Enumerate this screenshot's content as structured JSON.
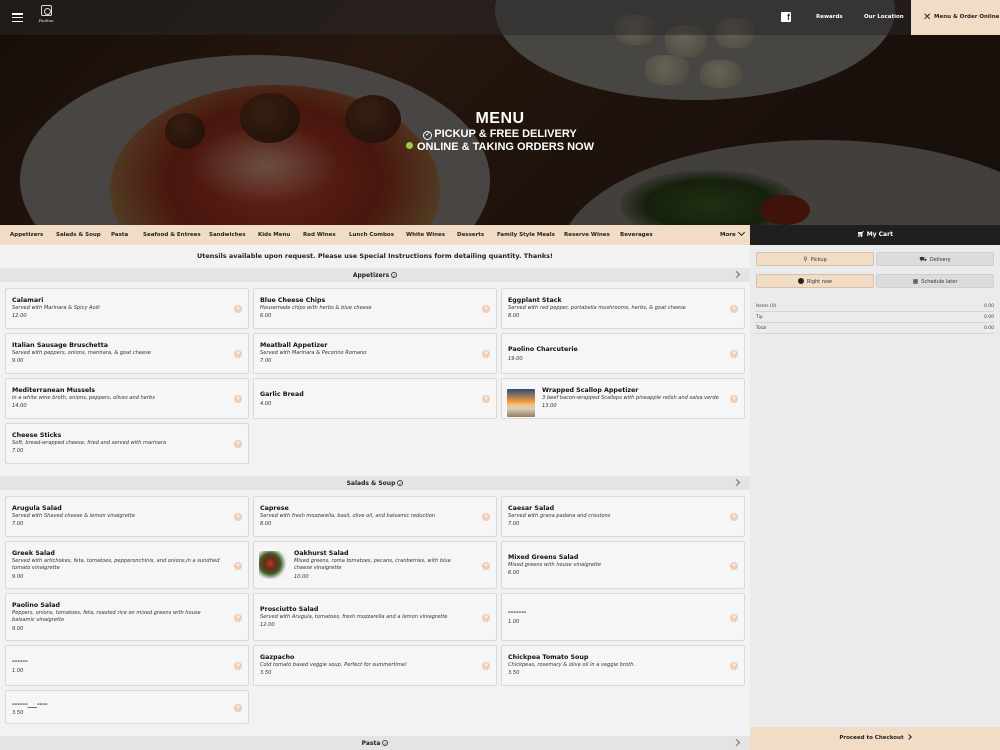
{
  "header": {
    "logo_text": "Paolino",
    "links": [
      "Rewards",
      "Our Location"
    ],
    "order_button": "Menu & Order Online"
  },
  "hero": {
    "title": "MENU",
    "line1": "PICKUP & FREE DELIVERY",
    "line2": "ONLINE & TAKING ORDERS NOW"
  },
  "categories": [
    "Appetizers",
    "Salads & Soup",
    "Pasta",
    "Seafood & Entrees",
    "Sandwiches",
    "Kids Menu",
    "Red Wines",
    "Lunch Combos",
    "White Wines",
    "Desserts",
    "Family Style Meals",
    "Reserve Wines",
    "Beverages"
  ],
  "more_label": "More",
  "notice": "Utensils available upon request. Please use Special Instructions form detailing quantity. Thanks!",
  "sections": [
    {
      "title": "Appetizers",
      "items": [
        {
          "name": "Calamari",
          "desc": "Served with Marinara & Spicy Aoili",
          "price": "12.00"
        },
        {
          "name": "Blue Cheese Chips",
          "desc": "Housemade chips with herbs & blue cheese",
          "price": "6.00"
        },
        {
          "name": "Eggplant Stack",
          "desc": "Served with red pepper, portabella mushrooms, herbs, & goat cheese",
          "price": "8.00"
        },
        {
          "name": "Italian Sausage Bruschetta",
          "desc": "Served with peppers, onions, marinara, & goat cheese",
          "price": "9.00"
        },
        {
          "name": "Meatball Appetizer",
          "desc": "Served with Marinara & Pecorino Romano",
          "price": "7.00"
        },
        {
          "name": "Paolino Charcuterie",
          "desc": "",
          "price": "19.00"
        },
        {
          "name": "Mediterranean Mussels",
          "desc": "in a white wine broth, onions, peppers, olives and herbs",
          "price": "14.00"
        },
        {
          "name": "Garlic Bread",
          "desc": "",
          "price": "4.00"
        },
        {
          "name": "Wrapped Scallop Appetizer",
          "desc": "3 beef bacon-wrapped Scallops with pineapple relish and salsa verde",
          "price": "13.00"
        },
        {
          "name": "Cheese Sticks",
          "desc": "Soft, bread-wrapped cheese, fried and served with marinara",
          "price": "7.00"
        }
      ]
    },
    {
      "title": "Salads & Soup",
      "items": [
        {
          "name": "Arugula Salad",
          "desc": "Served with Shaved cheese & lemon vinaigrette",
          "price": "7.00"
        },
        {
          "name": "Caprese",
          "desc": "Served with fresh mozzarella, basil, olive oil, and balsamic reduction",
          "price": "8.00"
        },
        {
          "name": "Caesar Salad",
          "desc": "Served with grana padana and croutons",
          "price": "7.00"
        },
        {
          "name": "Greek Salad",
          "desc": "Served with artichokes, feta, tomatoes, pepperonchinis, and onions,in a sundried tomato vinaigrette",
          "price": "9.00"
        },
        {
          "name": "Oakhurst Salad",
          "desc": "Mixed greens, roma tomatoes, pecans, cranberries, with blue cheese vinaigrette",
          "price": "10.00"
        },
        {
          "name": "Mixed Greens Salad",
          "desc": "Mixed greens with house vinaigrette",
          "price": "6.00"
        },
        {
          "name": "Paolino Salad",
          "desc": "Peppers, onions, tomatoes, feta, roasted rice on mixed greens with house balsamic vinaigrette",
          "price": "9.00"
        },
        {
          "name": "Prosciutto Salad",
          "desc": "Served with Arugula, tomatoes, fresh mozzarella and a lemon viniagrette",
          "price": "12.00"
        },
        {
          "name": "-------",
          "desc": "",
          "price": "1.00"
        },
        {
          "name": "------",
          "desc": "",
          "price": "1.00"
        },
        {
          "name": "Gazpacho",
          "desc": "Cold tomato based veggie soup. Perfect for summertime!",
          "price": "3.50"
        },
        {
          "name": "Chickpea Tomato Soup",
          "desc": "Chickpeas, rosemary & olive oil in a veggie broth.",
          "price": "3.50"
        },
        {
          "name": "------___----",
          "desc": "",
          "price": "3.50"
        }
      ]
    },
    {
      "title": "Pasta",
      "items": []
    }
  ],
  "cart": {
    "title": "My Cart",
    "modes": [
      "Pickup",
      "Delivery"
    ],
    "timing": [
      "Right now",
      "Schedule later"
    ],
    "summary": [
      {
        "label": "Items (0)",
        "value": "0.00"
      },
      {
        "label": "Tip",
        "value": "0.00"
      },
      {
        "label": "Total",
        "value": "0.00"
      }
    ],
    "checkout": "Proceed to Checkout"
  },
  "colors": {
    "accent": "#f1dcc5",
    "cart_header": "#1f1f1f",
    "add_button": "#f0ccb0",
    "hero_dot": "#9ccc3c"
  },
  "icons": [
    "hamburger-menu-icon",
    "facebook-icon",
    "close-icon",
    "chevron-down-icon",
    "check-circle-icon",
    "chevron-right-icon",
    "cart-icon",
    "pickup-icon",
    "delivery-car-icon",
    "clock-icon",
    "calendar-icon",
    "plus-icon"
  ]
}
